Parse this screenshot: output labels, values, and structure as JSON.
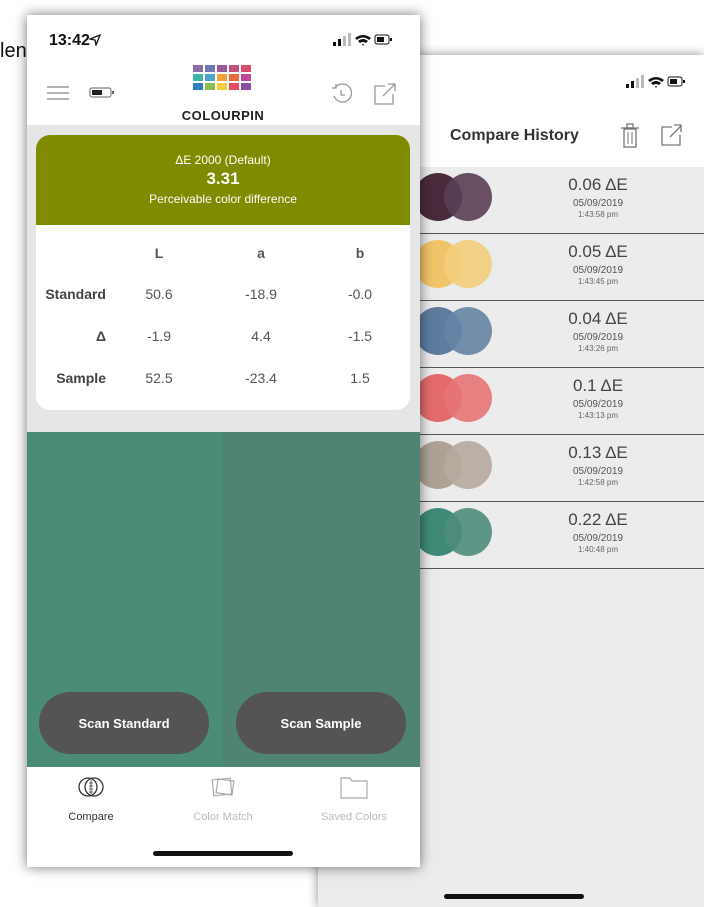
{
  "stray_text": "len",
  "history": {
    "title": "Compare History",
    "items": [
      {
        "de": "0.06 ΔE",
        "date": "05/09/2019",
        "time": "1:43:58 pm",
        "color_a": "#4a2b3c",
        "color_b": "#5a3e53"
      },
      {
        "de": "0.05 ΔE",
        "date": "05/09/2019",
        "time": "1:43:45 pm",
        "color_a": "#f0c56a",
        "color_b": "#f3cd7b"
      },
      {
        "de": "0.04 ΔE",
        "date": "05/09/2019",
        "time": "1:43:26 pm",
        "color_a": "#5d7c9e",
        "color_b": "#6684a4"
      },
      {
        "de": "0.1 ΔE",
        "date": "05/09/2019",
        "time": "1:43:13 pm",
        "color_a": "#e36b6b",
        "color_b": "#e77676"
      },
      {
        "de": "0.13 ΔE",
        "date": "05/09/2019",
        "time": "1:42:58 pm",
        "color_a": "#aea195",
        "color_b": "#b7aa9e"
      },
      {
        "de": "0.22 ΔE",
        "date": "05/09/2019",
        "time": "1:40:48 pm",
        "color_a": "#3f8a76",
        "color_b": "#4f8c7c"
      }
    ]
  },
  "status": {
    "time": "13:42"
  },
  "brand": {
    "name": "COLOURPIN"
  },
  "result": {
    "metric": "ΔE 2000 (Default)",
    "value": "3.31",
    "description": "Perceivable color difference",
    "band_color": "#7f8c00"
  },
  "lab": {
    "headers": [
      "L",
      "a",
      "b"
    ],
    "rows": [
      {
        "label": "Standard",
        "values": [
          "50.6",
          "-18.9",
          "-0.0"
        ]
      },
      {
        "label": "Δ",
        "values": [
          "-1.9",
          "4.4",
          "-1.5"
        ]
      },
      {
        "label": "Sample",
        "values": [
          "52.5",
          "-23.4",
          "1.5"
        ]
      }
    ]
  },
  "colors": {
    "standard": "#4a8c78",
    "sample": "#4f8475"
  },
  "buttons": {
    "scan_standard": "Scan Standard",
    "scan_sample": "Scan Sample"
  },
  "tabs": [
    {
      "label": "Compare",
      "icon": "compare-icon"
    },
    {
      "label": "Color Match",
      "icon": "color-match-icon"
    },
    {
      "label": "Saved Colors",
      "icon": "folder-icon"
    }
  ]
}
